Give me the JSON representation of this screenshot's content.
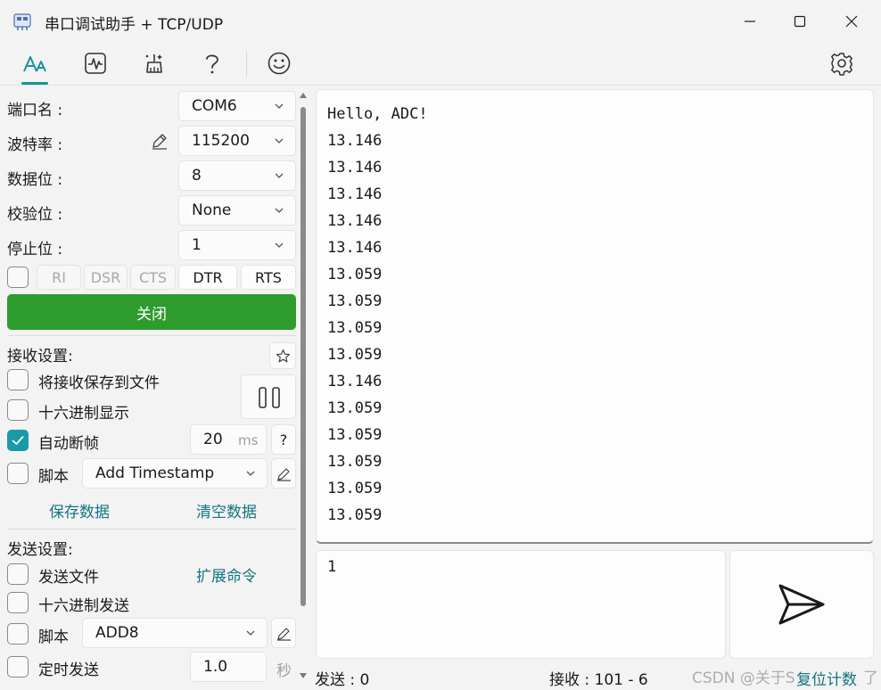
{
  "window": {
    "title": "串口调试助手 + TCP/UDP"
  },
  "toolbar": {
    "icons": [
      "font-icon",
      "waveform-icon",
      "clean-icon",
      "help-icon",
      "smiley-icon",
      "gear-icon"
    ],
    "accent": "#17929c"
  },
  "serial": {
    "port_label": "端口名 :",
    "port_value": "COM6",
    "baud_label": "波特率 :",
    "baud_value": "115200",
    "databits_label": "数据位 :",
    "databits_value": "8",
    "parity_label": "校验位 :",
    "parity_value": "None",
    "stopbits_label": "停止位 :",
    "stopbits_value": "1",
    "signals": [
      "RI",
      "DSR",
      "CTS",
      "DTR",
      "RTS"
    ],
    "close_label": "关闭",
    "close_color": "#2e9b2e"
  },
  "receive": {
    "section_label": "接收设置:",
    "save_to_file": "将接收保存到文件",
    "hex_display": "十六进制显示",
    "auto_frame": "自动断帧",
    "auto_frame_value": "20",
    "auto_frame_unit": "ms",
    "help": "?",
    "script_label": "脚本",
    "script_value": "Add Timestamp",
    "save_data": "保存数据",
    "clear_data": "清空数据"
  },
  "send": {
    "section_label": "发送设置:",
    "send_file": "发送文件",
    "ext_cmd": "扩展命令",
    "hex_send": "十六进制发送",
    "script_label": "脚本",
    "script_value": "ADD8",
    "timer_send": "定时发送",
    "timer_value": "1.0",
    "timer_unit": "秒",
    "input_value": "1"
  },
  "output": {
    "lines": [
      "Hello, ADC!",
      "13.146",
      "13.146",
      "13.146",
      "13.146",
      "13.146",
      "13.059",
      "13.059",
      "13.059",
      "13.059",
      "13.146",
      "13.059",
      "13.059",
      "13.059",
      "13.059",
      "13.059"
    ]
  },
  "status": {
    "sent": "发送 : 0",
    "recv": "接收 : 101  -  6",
    "reset": "复位计数"
  },
  "watermark": "CSDN @关于S",
  "watermark_tail": "了"
}
